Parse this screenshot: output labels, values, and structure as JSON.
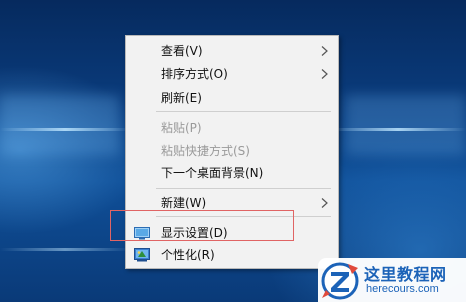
{
  "menu": {
    "items": [
      {
        "label": "查看(V)",
        "submenu": true,
        "enabled": true
      },
      {
        "label": "排序方式(O)",
        "submenu": true,
        "enabled": true
      },
      {
        "label": "刷新(E)",
        "submenu": false,
        "enabled": true
      },
      {
        "label": "粘贴(P)",
        "submenu": false,
        "enabled": false
      },
      {
        "label": "粘贴快捷方式(S)",
        "submenu": false,
        "enabled": false
      },
      {
        "label": "下一个桌面背景(N)",
        "submenu": false,
        "enabled": true
      },
      {
        "label": "新建(W)",
        "submenu": true,
        "enabled": true
      },
      {
        "label": "显示设置(D)",
        "submenu": false,
        "enabled": true,
        "icon": "display-settings-icon",
        "highlighted": true
      },
      {
        "label": "个性化(R)",
        "submenu": false,
        "enabled": true,
        "icon": "personalize-icon"
      }
    ]
  },
  "highlight_color": "#e06464",
  "watermark": {
    "title": "这里教程网",
    "url": "herecours.com",
    "color": "#1c63b8"
  }
}
